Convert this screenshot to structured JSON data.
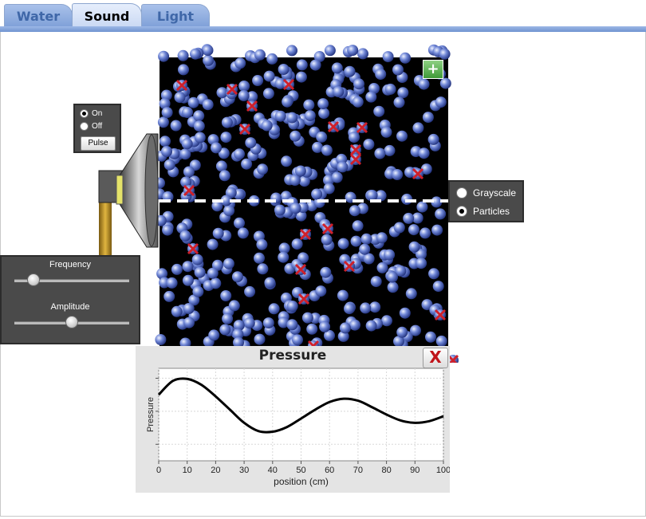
{
  "tabs": [
    {
      "label": "Water",
      "active": false
    },
    {
      "label": "Sound",
      "active": true
    },
    {
      "label": "Light",
      "active": false
    }
  ],
  "speaker_panel": {
    "on_label": "On",
    "off_label": "Off",
    "selected": "On",
    "pulse_label": "Pulse"
  },
  "sliders": {
    "frequency_label": "Frequency",
    "frequency_value": 0.17,
    "amplitude_label": "Amplitude",
    "amplitude_value": 0.5
  },
  "view_selector": {
    "grayscale_label": "Grayscale",
    "particles_label": "Particles",
    "selected": "Particles"
  },
  "zoom_button": "+",
  "graph": {
    "title": "Pressure",
    "close_label": "X"
  },
  "colors": {
    "particle": "#6f86d6",
    "marker": "#d0202a",
    "background": "#000000",
    "tab_accent": "#7fa0d8"
  },
  "chart_data": {
    "type": "line",
    "title": "Pressure",
    "xlabel": "position (cm)",
    "ylabel": "Pressure",
    "xlim": [
      0,
      100
    ],
    "xticks": [
      0,
      10,
      20,
      30,
      40,
      50,
      60,
      70,
      80,
      90,
      100
    ],
    "x": [
      0,
      5,
      10,
      15,
      20,
      25,
      30,
      35,
      40,
      45,
      50,
      55,
      60,
      65,
      70,
      75,
      80,
      85,
      90,
      95,
      100
    ],
    "y": [
      0.5,
      0.92,
      0.98,
      0.8,
      0.45,
      0.05,
      -0.35,
      -0.6,
      -0.62,
      -0.48,
      -0.22,
      0.05,
      0.28,
      0.38,
      0.32,
      0.12,
      -0.1,
      -0.28,
      -0.35,
      -0.3,
      -0.15
    ],
    "ylim": [
      -1.5,
      1.3
    ],
    "grid": true
  }
}
